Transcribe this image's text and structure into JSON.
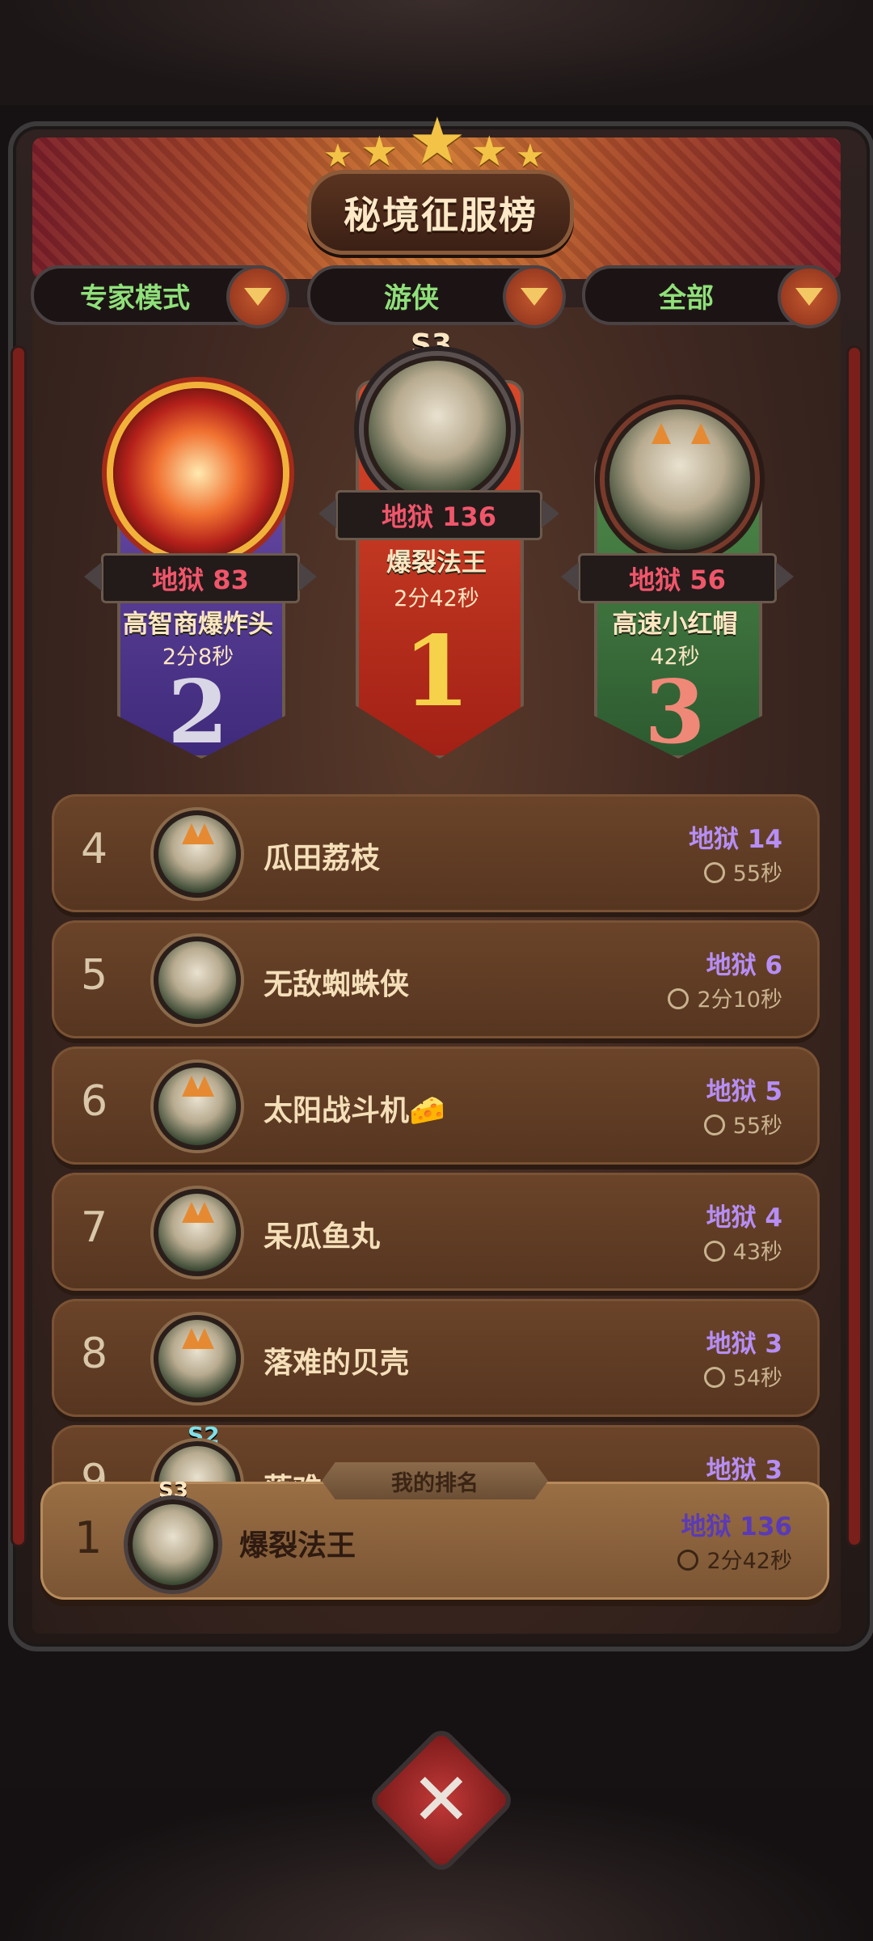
{
  "title": "秘境征服榜",
  "filters": [
    {
      "label": "专家模式"
    },
    {
      "label": "游侠"
    },
    {
      "label": "全部"
    }
  ],
  "podium": {
    "first": {
      "season": "S3",
      "level": "地狱 136",
      "name": "爆裂法王",
      "time": "2分42秒",
      "rank": "1"
    },
    "second": {
      "level": "地狱 83",
      "name": "高智商爆炸头",
      "time": "2分8秒",
      "rank": "2"
    },
    "third": {
      "level": "地狱 56",
      "name": "高速小红帽",
      "time": "42秒",
      "rank": "3"
    }
  },
  "rows": [
    {
      "rank": "4",
      "name": "瓜田荔枝",
      "level": "地狱 14",
      "time": "55秒"
    },
    {
      "rank": "5",
      "name": "无敌蜘蛛侠",
      "level": "地狱 6",
      "time": "2分10秒"
    },
    {
      "rank": "6",
      "name": "太阳战斗机🧀",
      "level": "地狱 5",
      "time": "55秒"
    },
    {
      "rank": "7",
      "name": "呆瓜鱼丸",
      "level": "地狱 4",
      "time": "43秒"
    },
    {
      "rank": "8",
      "name": "落难的贝壳",
      "level": "地狱 3",
      "time": "54秒"
    },
    {
      "rank": "9",
      "name": "落难",
      "level": "地狱 3",
      "season": "S2"
    }
  ],
  "my_rank": {
    "label": "我的排名",
    "rank": "1",
    "season": "S3",
    "name": "爆裂法王",
    "level": "地狱 136",
    "time": "2分42秒"
  },
  "close_icon": "crossed-swords-close-icon"
}
